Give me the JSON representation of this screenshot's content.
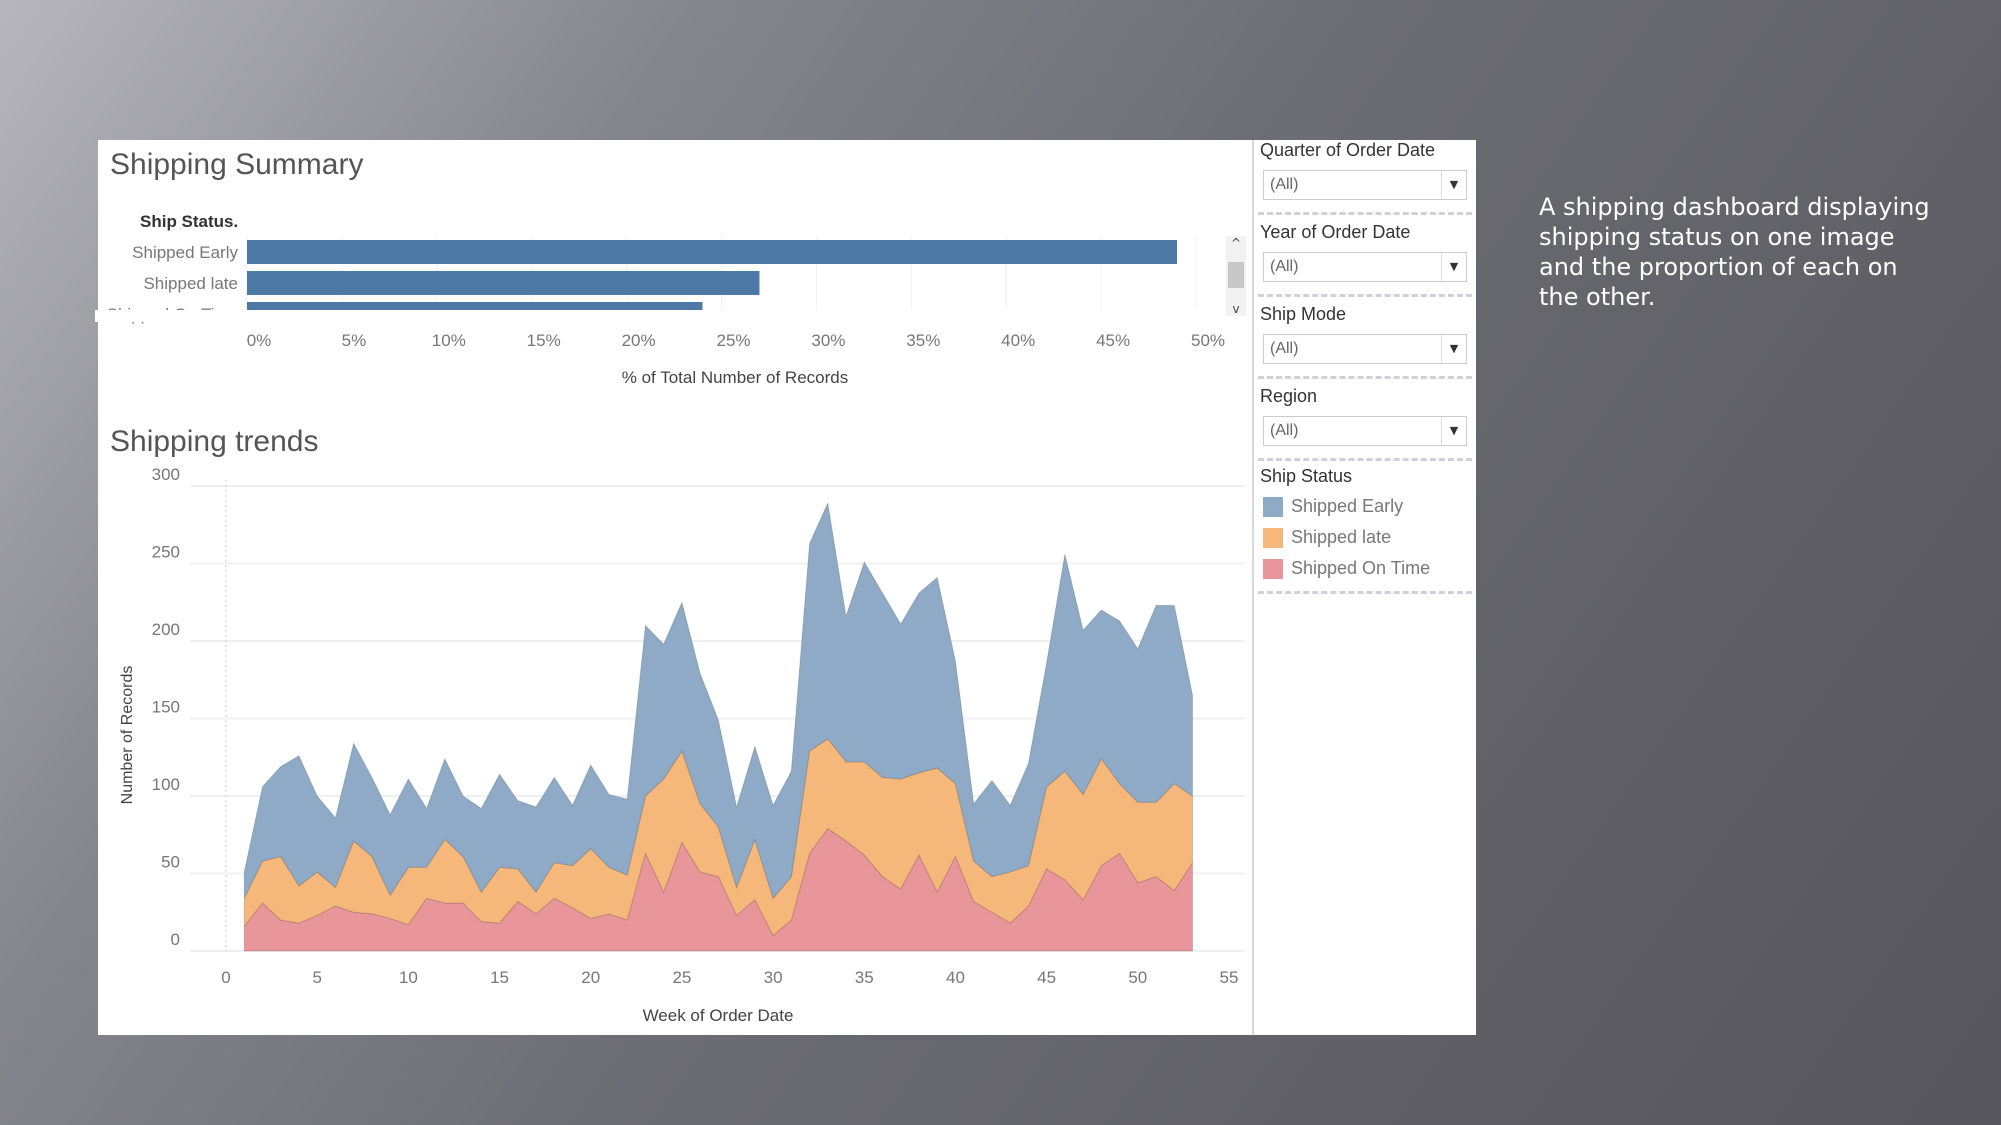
{
  "caption": "A shipping dashboard displaying shipping status on one image and the proportion of each on the other.",
  "summary": {
    "title": "Shipping Summary",
    "row_header": "Ship Status."
  },
  "trends": {
    "title": "Shipping trends"
  },
  "filters": [
    {
      "label": "Quarter of Order Date",
      "value": "(All)"
    },
    {
      "label": "Year of Order Date",
      "value": "(All)"
    },
    {
      "label": "Ship Mode",
      "value": "(All)"
    },
    {
      "label": "Region",
      "value": "(All)"
    }
  ],
  "legend": {
    "title": "Ship Status",
    "items": [
      {
        "label": "Shipped Early",
        "color": "#8eaac6"
      },
      {
        "label": "Shipped late",
        "color": "#f5b77a"
      },
      {
        "label": "Shipped On Time",
        "color": "#e8969a"
      }
    ]
  },
  "scrollbar": {
    "up_icon": "chevron-up-icon",
    "down_icon": "chevron-down-icon"
  },
  "chart_data": [
    {
      "type": "bar",
      "orientation": "horizontal",
      "categories": [
        "Shipped Early",
        "Shipped late",
        "Shipped On Time"
      ],
      "values": [
        49,
        27,
        24
      ],
      "xlabel": "% of Total Number of Records",
      "xlim": [
        0,
        50
      ],
      "ticks": [
        "0%",
        "5%",
        "10%",
        "15%",
        "20%",
        "25%",
        "30%",
        "35%",
        "40%",
        "45%",
        "50%"
      ],
      "color": "#4e79a7",
      "grid": true
    },
    {
      "type": "area",
      "stacked": true,
      "xlabel": "Week of Order Date",
      "ylabel": "Number of Records",
      "xlim": [
        0,
        55
      ],
      "ylim": [
        0,
        300
      ],
      "xticks": [
        0,
        5,
        10,
        15,
        20,
        25,
        30,
        35,
        40,
        45,
        50,
        55
      ],
      "yticks": [
        0,
        50,
        100,
        150,
        200,
        250,
        300
      ],
      "grid": true,
      "x": [
        1,
        2,
        3,
        4,
        5,
        6,
        7,
        8,
        9,
        10,
        11,
        12,
        13,
        14,
        15,
        16,
        17,
        18,
        19,
        20,
        21,
        22,
        23,
        24,
        25,
        26,
        27,
        28,
        29,
        30,
        31,
        32,
        33,
        34,
        35,
        36,
        37,
        38,
        39,
        40,
        41,
        42,
        43,
        44,
        45,
        46,
        47,
        48,
        49,
        50,
        51,
        52,
        53
      ],
      "series": [
        {
          "name": "Shipped On Time",
          "color": "#e8969a",
          "values": [
            16,
            31,
            20,
            18,
            23,
            29,
            25,
            24,
            21,
            17,
            34,
            31,
            31,
            19,
            18,
            32,
            24,
            34,
            28,
            21,
            24,
            20,
            63,
            38,
            70,
            51,
            48,
            23,
            33,
            10,
            20,
            63,
            79,
            71,
            62,
            48,
            40,
            62,
            38,
            61,
            32,
            25,
            18,
            29,
            53,
            46,
            33,
            55,
            63,
            44,
            48,
            39,
            57
          ]
        },
        {
          "name": "Shipped late",
          "color": "#f5b77a",
          "values": [
            18,
            27,
            41,
            24,
            28,
            12,
            46,
            37,
            15,
            37,
            20,
            41,
            30,
            19,
            36,
            21,
            14,
            23,
            27,
            45,
            30,
            29,
            37,
            73,
            59,
            44,
            32,
            18,
            39,
            24,
            28,
            66,
            58,
            51,
            60,
            64,
            71,
            53,
            80,
            47,
            26,
            23,
            33,
            26,
            53,
            70,
            68,
            69,
            45,
            52,
            48,
            69,
            43
          ]
        },
        {
          "name": "Shipped Early",
          "color": "#8eaac6",
          "values": [
            17,
            48,
            58,
            84,
            49,
            45,
            63,
            51,
            52,
            57,
            38,
            52,
            39,
            54,
            60,
            44,
            55,
            55,
            39,
            54,
            47,
            49,
            110,
            87,
            96,
            84,
            69,
            52,
            60,
            60,
            68,
            134,
            152,
            94,
            129,
            119,
            100,
            116,
            123,
            79,
            37,
            62,
            43,
            66,
            80,
            140,
            106,
            96,
            105,
            99,
            127,
            115,
            65
          ]
        }
      ]
    }
  ]
}
